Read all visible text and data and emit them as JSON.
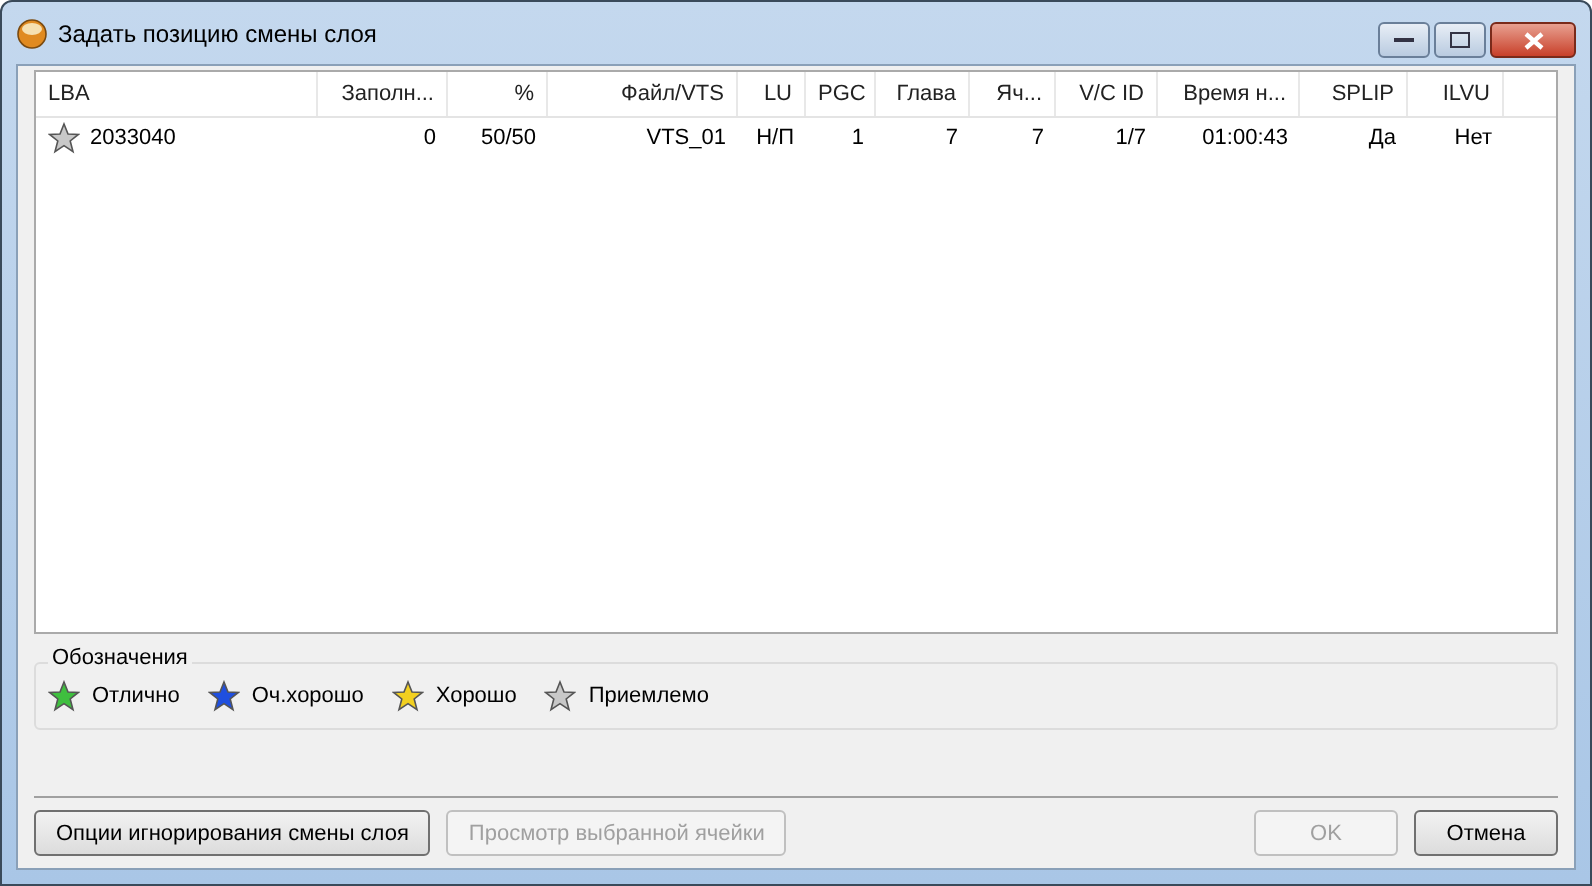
{
  "window": {
    "title": "Задать позицию смены слоя"
  },
  "table": {
    "columns": [
      "LBA",
      "Заполн...",
      "%",
      "Файл/VTS",
      "LU",
      "PGC",
      "Глава",
      "Яч...",
      "V/C ID",
      "Время н...",
      "SPLIP",
      "ILVU"
    ],
    "rows": [
      {
        "color": "#c8c8c8",
        "cells": [
          "2033040",
          "0",
          "50/50",
          "VTS_01",
          "Н/П",
          "1",
          "7",
          "7",
          "1/7",
          "01:00:43",
          "Да",
          "Нет"
        ]
      }
    ]
  },
  "legend": {
    "title": "Обозначения",
    "items": [
      {
        "label": "Отлично",
        "color": "#3fbf3f"
      },
      {
        "label": "Оч.хорошо",
        "color": "#1f4fdf"
      },
      {
        "label": "Хорошо",
        "color": "#f2d020"
      },
      {
        "label": "Приемлемо",
        "color": "#c8c8c8"
      }
    ]
  },
  "buttons": [
    {
      "label": "Опции игнорирования смены слоя",
      "disabled": false,
      "kind": "left"
    },
    {
      "label": "Просмотр выбранной ячейки",
      "disabled": true,
      "kind": "left"
    },
    {
      "label": "OK",
      "disabled": true,
      "kind": "right"
    },
    {
      "label": "Отмена",
      "disabled": false,
      "kind": "right"
    }
  ]
}
